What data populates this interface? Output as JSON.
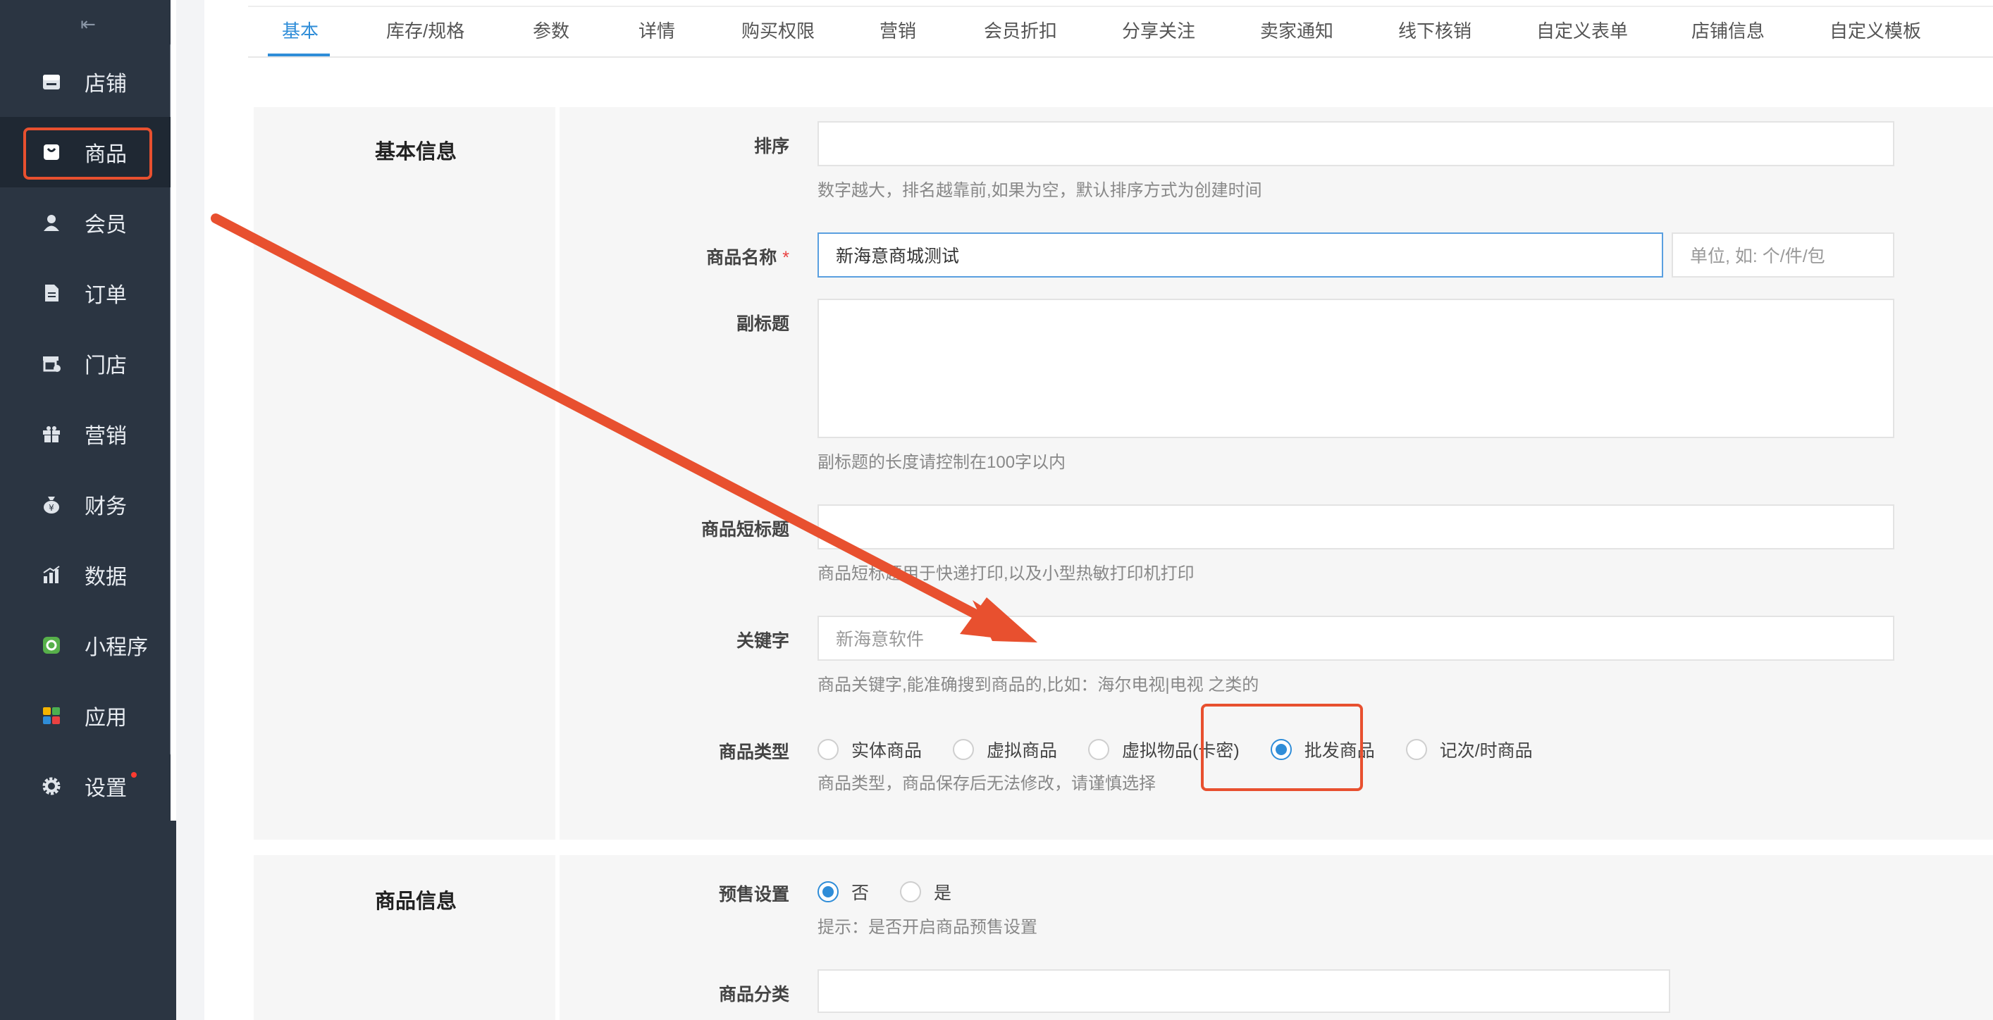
{
  "sidebar": {
    "collapse_icon": "collapse-icon",
    "items": [
      {
        "label": "店铺",
        "icon": "store-icon"
      },
      {
        "label": "商品",
        "icon": "goods-bag-icon"
      },
      {
        "label": "会员",
        "icon": "member-icon"
      },
      {
        "label": "订单",
        "icon": "order-icon"
      },
      {
        "label": "门店",
        "icon": "shop-icon"
      },
      {
        "label": "营销",
        "icon": "gift-icon"
      },
      {
        "label": "财务",
        "icon": "money-bag-icon"
      },
      {
        "label": "数据",
        "icon": "chart-icon"
      },
      {
        "label": "小程序",
        "icon": "miniprogram-icon"
      },
      {
        "label": "应用",
        "icon": "apps-icon"
      },
      {
        "label": "设置",
        "icon": "gear-icon"
      }
    ]
  },
  "tabs": [
    "基本",
    "库存/规格",
    "参数",
    "详情",
    "购买权限",
    "营销",
    "会员折扣",
    "分享关注",
    "卖家通知",
    "线下核销",
    "自定义表单",
    "店铺信息",
    "自定义模板"
  ],
  "basic_section": {
    "title": "基本信息",
    "sort": {
      "label": "排序",
      "value": "",
      "hint": "数字越大，排名越靠前,如果为空，默认排序方式为创建时间"
    },
    "name": {
      "label": "商品名称",
      "required": "*",
      "value": "新海意商城测试",
      "unit_placeholder": "单位, 如: 个/件/包"
    },
    "subtitle": {
      "label": "副标题",
      "value": "",
      "hint": "副标题的长度请控制在100字以内"
    },
    "short_title": {
      "label": "商品短标题",
      "value": "",
      "hint": "商品短标题用于快递打印,以及小型热敏打印机打印"
    },
    "keyword": {
      "label": "关键字",
      "placeholder": "新海意软件",
      "hint": "商品关键字,能准确搜到商品的,比如：海尔电视|电视 之类的"
    },
    "type": {
      "label": "商品类型",
      "options": [
        "实体商品",
        "虚拟商品",
        "虚拟物品(卡密)",
        "批发商品",
        "记次/时商品"
      ],
      "selected": "批发商品",
      "hint": "商品类型，商品保存后无法修改，请谨慎选择"
    }
  },
  "goods_section": {
    "title": "商品信息",
    "presale": {
      "label": "预售设置",
      "options": [
        "否",
        "是"
      ],
      "selected": "否",
      "hint": "提示：是否开启商品预售设置"
    },
    "category": {
      "label": "商品分类",
      "value": ""
    }
  },
  "annotation_color": "#e8502f",
  "accent_color": "#2f8dd8"
}
